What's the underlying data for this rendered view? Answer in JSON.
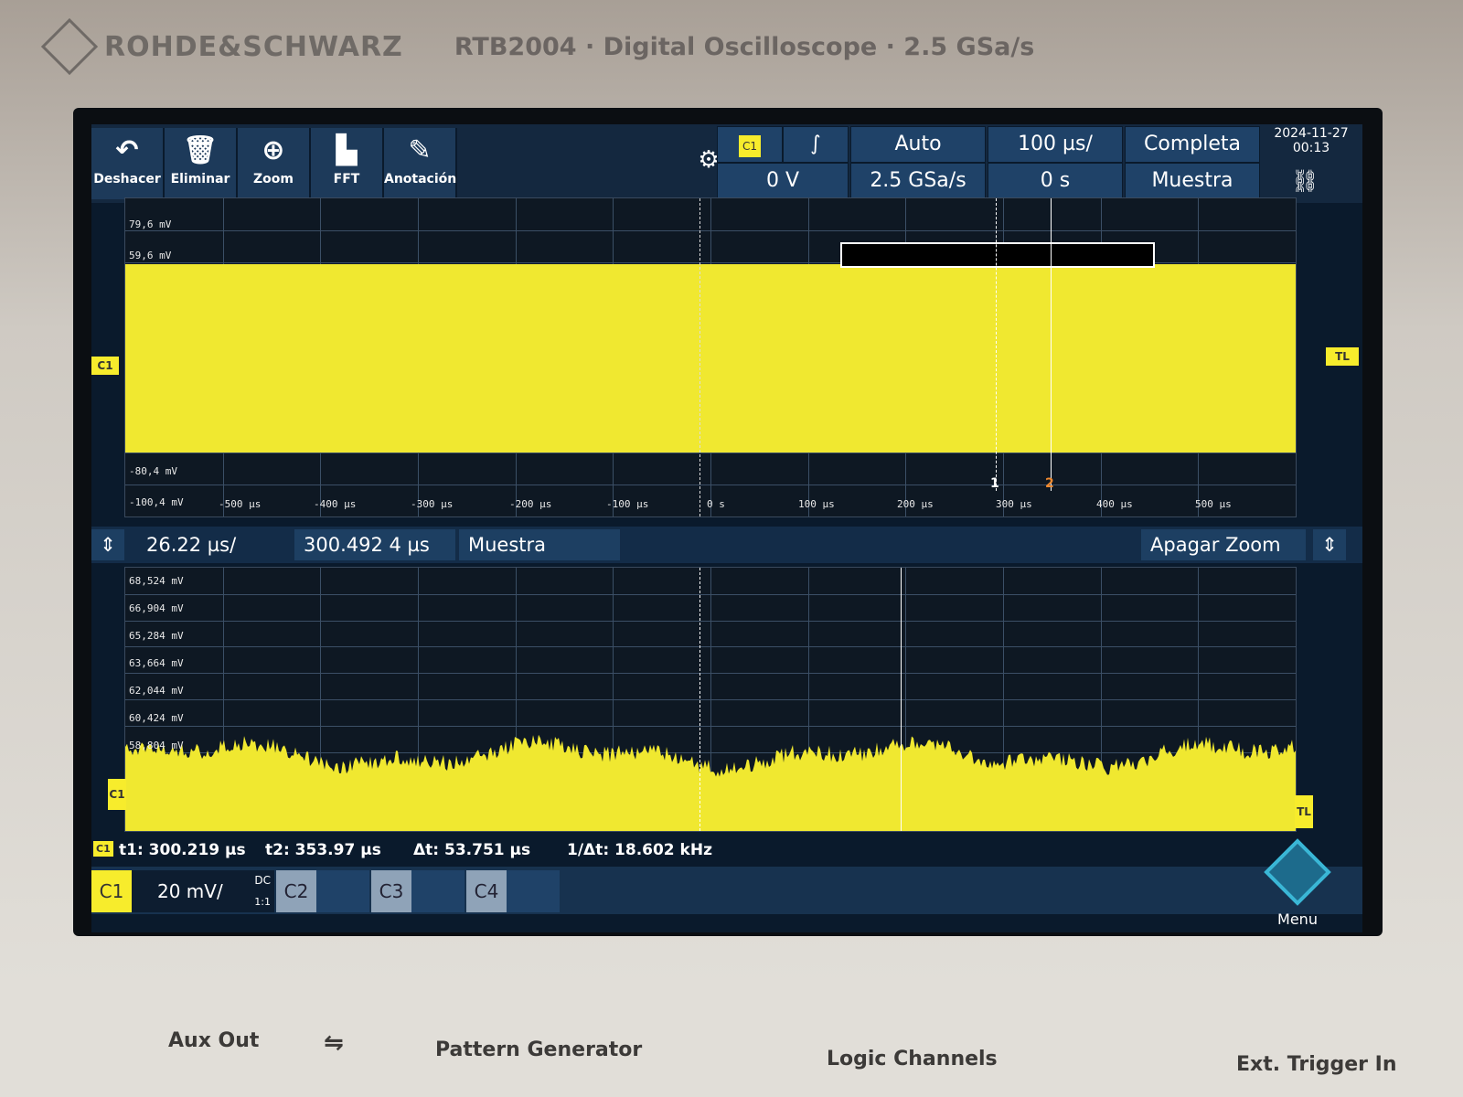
{
  "brand": {
    "name": "ROHDE&SCHWARZ",
    "model": "RTB2004 · Digital Oscilloscope · 2.5 GSa/s"
  },
  "toolbar": {
    "tools": [
      {
        "label": "Deshacer",
        "icon": "undo-icon"
      },
      {
        "label": "Eliminar",
        "icon": "trash-icon"
      },
      {
        "label": "Zoom",
        "icon": "zoom-icon"
      },
      {
        "label": "FFT",
        "icon": "fft-icon"
      },
      {
        "label": "Anotación",
        "icon": "pencil-icon"
      }
    ],
    "trigger_source": "C1",
    "trigger_slope": "∫",
    "trigger_level": "0 V",
    "trigger_mode": "Auto",
    "sample_rate": "2.5 GSa/s",
    "timebase": "100 µs/",
    "time_offset": "0 s",
    "acquire": "Completa",
    "acq_mode": "Muestra",
    "date": "2024-11-27",
    "time": "00:13"
  },
  "upper_plot": {
    "y_labels": [
      "79,6 mV",
      "59,6 mV",
      "-80,4 mV",
      "-100,4 mV"
    ],
    "x_labels": [
      "-500 µs",
      "-400 µs",
      "-300 µs",
      "-200 µs",
      "-100 µs",
      "0 s",
      "100 µs",
      "200 µs",
      "300 µs",
      "400 µs",
      "500 µs"
    ],
    "left_marker": "C1",
    "right_marker": "TL",
    "cursor1": "1",
    "cursor2": "2"
  },
  "zoombar": {
    "scale": "26.22 µs/",
    "position": "300.492 4 µs",
    "mode": "Muestra",
    "off_label": "Apagar Zoom"
  },
  "lower_plot": {
    "y_labels": [
      "68,524 mV",
      "66,904 mV",
      "65,284 mV",
      "63,664 mV",
      "62,044 mV",
      "60,424 mV",
      "58,804 mV"
    ],
    "left_marker": "C1",
    "right_marker": "TL"
  },
  "measurements": {
    "ch": "C1",
    "t1": "t1: 300.219 µs",
    "t2": "t2: 353.97 µs",
    "dt": "Δt: 53.751 µs",
    "inv_dt": "1/Δt: 18.602 kHz"
  },
  "channels": {
    "c1": "C1",
    "c1_scale": "20 mV/",
    "c1_coupling": "DC",
    "c1_probe": "1:1",
    "c2": "C2",
    "c3": "C3",
    "c4": "C4",
    "menu": "Menu"
  },
  "panel": {
    "aux": "Aux Out",
    "pattern": "Pattern Generator",
    "logic": "Logic Channels",
    "ext": "Ext. Trigger In"
  },
  "colors": {
    "trace": "#f0e830",
    "ch1": "#f7ec2c",
    "cursor2": "#f08a30"
  }
}
